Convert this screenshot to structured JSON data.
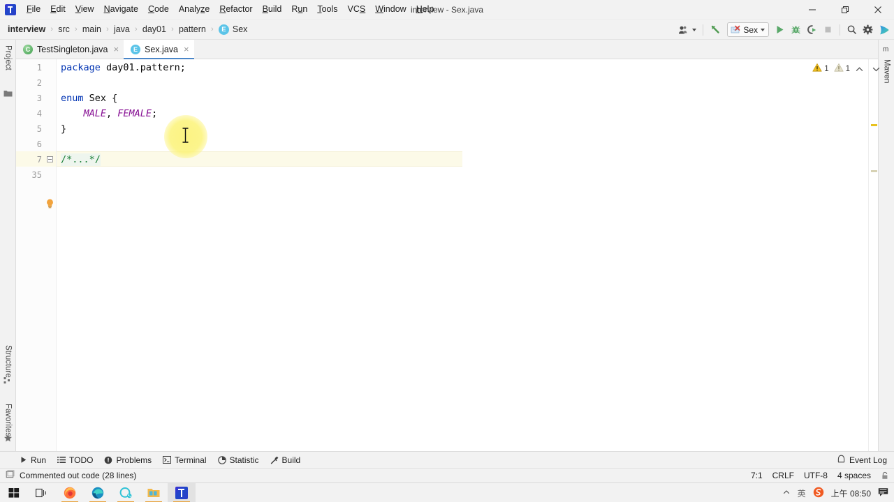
{
  "window": {
    "title": "interview - Sex.java",
    "logo_icon": "intellij-idea-logo",
    "minimize_icon": "minimize-icon",
    "maximize_icon": "maximize-icon",
    "close_icon": "close-icon"
  },
  "menubar": {
    "items": [
      {
        "label": "File",
        "mnemonic": "F"
      },
      {
        "label": "Edit",
        "mnemonic": "E"
      },
      {
        "label": "View",
        "mnemonic": "V"
      },
      {
        "label": "Navigate",
        "mnemonic": "N"
      },
      {
        "label": "Code",
        "mnemonic": "C"
      },
      {
        "label": "Analyze",
        "mnemonic": "z"
      },
      {
        "label": "Refactor",
        "mnemonic": "R"
      },
      {
        "label": "Build",
        "mnemonic": "B"
      },
      {
        "label": "Run",
        "mnemonic": "u"
      },
      {
        "label": "Tools",
        "mnemonic": "T"
      },
      {
        "label": "VCS",
        "mnemonic": "S"
      },
      {
        "label": "Window",
        "mnemonic": "W"
      },
      {
        "label": "Help",
        "mnemonic": "H"
      }
    ]
  },
  "breadcrumb": {
    "separator": "›",
    "items": [
      {
        "label": "interview",
        "icon": ""
      },
      {
        "label": "src",
        "icon": ""
      },
      {
        "label": "main",
        "icon": ""
      },
      {
        "label": "java",
        "icon": ""
      },
      {
        "label": "day01",
        "icon": ""
      },
      {
        "label": "pattern",
        "icon": ""
      },
      {
        "label": "Sex",
        "icon": "E"
      }
    ]
  },
  "toolbar": {
    "user_icon": "user-account-icon",
    "back_icon": "back-arrow-icon",
    "run_config": {
      "label": "Sex",
      "icon": "run-config-error-icon"
    },
    "run_icon": "run-icon",
    "debug_icon": "debug-icon",
    "coverage_icon": "run-with-coverage-icon",
    "stop_icon": "stop-icon",
    "search_icon": "search-everywhere-icon",
    "settings_icon": "settings-gear-icon",
    "assistant_icon": "ide-assistant-icon"
  },
  "left_stripe": {
    "tabs": [
      {
        "label": "Project",
        "icon": "project-folder-icon"
      },
      {
        "label": "Structure",
        "icon": "structure-icon"
      },
      {
        "label": "Favorites",
        "icon": "favorites-star-icon"
      }
    ]
  },
  "right_stripe": {
    "tabs": [
      {
        "label": "Maven",
        "icon": "maven-icon"
      }
    ]
  },
  "editor_tabs": [
    {
      "label": "TestSingleton.java",
      "icon": "class-file-icon",
      "kind": "cls",
      "active": false,
      "close": "×"
    },
    {
      "label": "Sex.java",
      "icon": "enum-file-icon",
      "kind": "enm",
      "active": true,
      "close": "×"
    }
  ],
  "editor": {
    "line_numbers": [
      "1",
      "2",
      "3",
      "4",
      "5",
      "6",
      "7",
      "35"
    ],
    "lines": [
      {
        "n": "1",
        "tokens": [
          {
            "t": "package",
            "c": "kw"
          },
          {
            "t": " day01.pattern;",
            "c": "punc"
          }
        ]
      },
      {
        "n": "2",
        "tokens": []
      },
      {
        "n": "3",
        "tokens": [
          {
            "t": "enum",
            "c": "kw"
          },
          {
            "t": " Sex {",
            "c": "punc"
          }
        ]
      },
      {
        "n": "4",
        "tokens": [
          {
            "t": "    ",
            "c": "punc"
          },
          {
            "t": "MALE",
            "c": "const"
          },
          {
            "t": ", ",
            "c": "punc"
          },
          {
            "t": "FEMALE",
            "c": "const"
          },
          {
            "t": ";",
            "c": "punc"
          }
        ]
      },
      {
        "n": "5",
        "tokens": [
          {
            "t": "}",
            "c": "punc"
          }
        ]
      },
      {
        "n": "6",
        "tokens": []
      },
      {
        "n": "7",
        "tokens": [
          {
            "t": "/*...*/",
            "c": "fold-hl"
          }
        ]
      }
    ],
    "folded_placeholder": "/*...*/",
    "bulb_icon": "intention-bulb-icon",
    "fold_icon": "fold-expand-icon",
    "caret_icon": "text-ibeam-cursor",
    "click_indicator": "click-highlight"
  },
  "inspections": {
    "warning_icon": "warning-triangle-icon",
    "warning_count": "1",
    "weak_warning_icon": "weak-warning-triangle-icon",
    "weak_warning_count": "1",
    "prev_icon": "chevron-up-icon",
    "next_icon": "chevron-down-icon"
  },
  "tool_windows": [
    {
      "label": "Run",
      "icon": "run-icon"
    },
    {
      "label": "TODO",
      "icon": "todo-list-icon"
    },
    {
      "label": "Problems",
      "icon": "problems-icon"
    },
    {
      "label": "Terminal",
      "icon": "terminal-icon"
    },
    {
      "label": "Statistic",
      "icon": "statistic-icon"
    },
    {
      "label": "Build",
      "icon": "build-hammer-icon"
    }
  ],
  "event_log": {
    "label": "Event Log",
    "icon": "event-log-bell-icon"
  },
  "statusbar": {
    "message": "Commented out code (28 lines)",
    "message_icon": "inspection-widget-icon",
    "caret_position": "7:1",
    "line_separator": "CRLF",
    "encoding": "UTF-8",
    "indent": "4 spaces",
    "lock_icon": "read-write-lock-icon"
  },
  "taskbar": {
    "items": [
      {
        "name": "start-button",
        "icon": "windows-start-icon",
        "active": false,
        "running": false
      },
      {
        "name": "task-view",
        "icon": "task-view-icon",
        "active": false,
        "running": false
      },
      {
        "name": "firefox",
        "icon": "firefox-icon",
        "active": false,
        "running": true
      },
      {
        "name": "edge",
        "icon": "edge-icon",
        "active": false,
        "running": true
      },
      {
        "name": "qq",
        "icon": "qq-icon",
        "active": false,
        "running": true
      },
      {
        "name": "file-explorer",
        "icon": "file-explorer-icon",
        "active": false,
        "running": true
      },
      {
        "name": "intellij-idea",
        "icon": "intellij-idea-icon",
        "active": true,
        "running": true
      }
    ],
    "tray": {
      "expand_icon": "chevron-up-icon",
      "ime_label": "英",
      "ime_logo": "sogou-ime-icon",
      "clock": "上午 08:50",
      "notification_icon": "notification-icon"
    }
  },
  "colors": {
    "accent": "#4a86c8",
    "keyword": "#0033b3",
    "constant": "#871094",
    "chrome": "#f2f2f2",
    "current_line": "#fcfae8",
    "warning": "#e8b230"
  }
}
